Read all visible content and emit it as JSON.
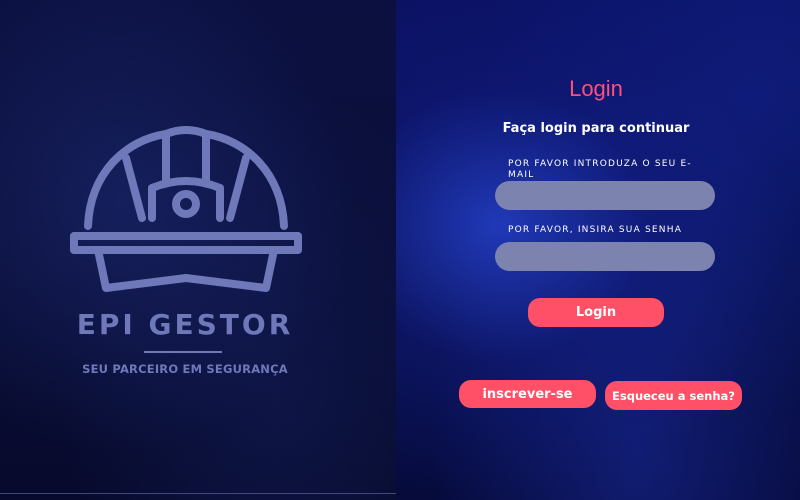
{
  "brand": {
    "name": "EPI GESTOR",
    "tagline": "SEU PARCEIRO EM SEGURANÇA",
    "logo_icon": "hard-hat-icon"
  },
  "login": {
    "title": "Login",
    "subtitle": "Faça login para continuar",
    "email_label": "POR FAVOR INTRODUZA O SEU E-MAIL",
    "email_value": "",
    "password_label": "POR FAVOR, INSIRA SUA SENHA",
    "password_value": "",
    "submit_label": "Login",
    "signup_label": "inscrever-se",
    "forgot_label": "Esqueceu a senha?"
  },
  "colors": {
    "accent": "#ff5068",
    "title": "#ff4f7a",
    "logo": "#6f78b8",
    "input_bg": "#7c83ae"
  }
}
